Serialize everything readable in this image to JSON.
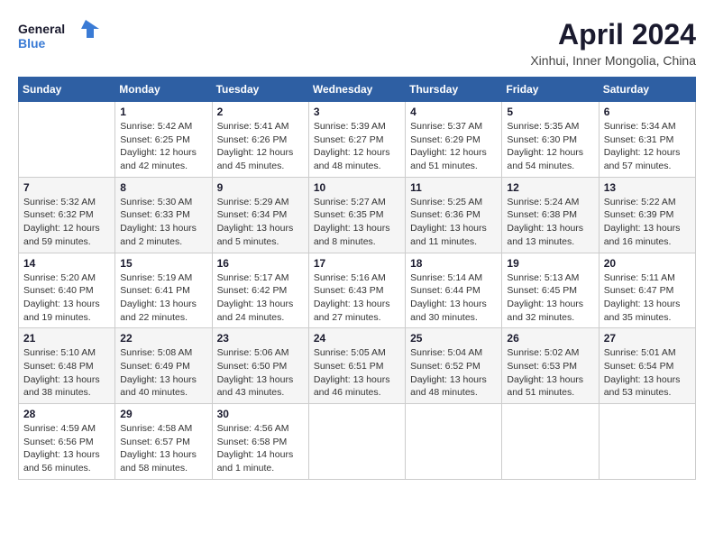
{
  "header": {
    "logo_line1": "General",
    "logo_line2": "Blue",
    "month_title": "April 2024",
    "subtitle": "Xinhui, Inner Mongolia, China"
  },
  "weekdays": [
    "Sunday",
    "Monday",
    "Tuesday",
    "Wednesday",
    "Thursday",
    "Friday",
    "Saturday"
  ],
  "weeks": [
    [
      {
        "day": "",
        "info": ""
      },
      {
        "day": "1",
        "info": "Sunrise: 5:42 AM\nSunset: 6:25 PM\nDaylight: 12 hours\nand 42 minutes."
      },
      {
        "day": "2",
        "info": "Sunrise: 5:41 AM\nSunset: 6:26 PM\nDaylight: 12 hours\nand 45 minutes."
      },
      {
        "day": "3",
        "info": "Sunrise: 5:39 AM\nSunset: 6:27 PM\nDaylight: 12 hours\nand 48 minutes."
      },
      {
        "day": "4",
        "info": "Sunrise: 5:37 AM\nSunset: 6:29 PM\nDaylight: 12 hours\nand 51 minutes."
      },
      {
        "day": "5",
        "info": "Sunrise: 5:35 AM\nSunset: 6:30 PM\nDaylight: 12 hours\nand 54 minutes."
      },
      {
        "day": "6",
        "info": "Sunrise: 5:34 AM\nSunset: 6:31 PM\nDaylight: 12 hours\nand 57 minutes."
      }
    ],
    [
      {
        "day": "7",
        "info": "Sunrise: 5:32 AM\nSunset: 6:32 PM\nDaylight: 12 hours\nand 59 minutes."
      },
      {
        "day": "8",
        "info": "Sunrise: 5:30 AM\nSunset: 6:33 PM\nDaylight: 13 hours\nand 2 minutes."
      },
      {
        "day": "9",
        "info": "Sunrise: 5:29 AM\nSunset: 6:34 PM\nDaylight: 13 hours\nand 5 minutes."
      },
      {
        "day": "10",
        "info": "Sunrise: 5:27 AM\nSunset: 6:35 PM\nDaylight: 13 hours\nand 8 minutes."
      },
      {
        "day": "11",
        "info": "Sunrise: 5:25 AM\nSunset: 6:36 PM\nDaylight: 13 hours\nand 11 minutes."
      },
      {
        "day": "12",
        "info": "Sunrise: 5:24 AM\nSunset: 6:38 PM\nDaylight: 13 hours\nand 13 minutes."
      },
      {
        "day": "13",
        "info": "Sunrise: 5:22 AM\nSunset: 6:39 PM\nDaylight: 13 hours\nand 16 minutes."
      }
    ],
    [
      {
        "day": "14",
        "info": "Sunrise: 5:20 AM\nSunset: 6:40 PM\nDaylight: 13 hours\nand 19 minutes."
      },
      {
        "day": "15",
        "info": "Sunrise: 5:19 AM\nSunset: 6:41 PM\nDaylight: 13 hours\nand 22 minutes."
      },
      {
        "day": "16",
        "info": "Sunrise: 5:17 AM\nSunset: 6:42 PM\nDaylight: 13 hours\nand 24 minutes."
      },
      {
        "day": "17",
        "info": "Sunrise: 5:16 AM\nSunset: 6:43 PM\nDaylight: 13 hours\nand 27 minutes."
      },
      {
        "day": "18",
        "info": "Sunrise: 5:14 AM\nSunset: 6:44 PM\nDaylight: 13 hours\nand 30 minutes."
      },
      {
        "day": "19",
        "info": "Sunrise: 5:13 AM\nSunset: 6:45 PM\nDaylight: 13 hours\nand 32 minutes."
      },
      {
        "day": "20",
        "info": "Sunrise: 5:11 AM\nSunset: 6:47 PM\nDaylight: 13 hours\nand 35 minutes."
      }
    ],
    [
      {
        "day": "21",
        "info": "Sunrise: 5:10 AM\nSunset: 6:48 PM\nDaylight: 13 hours\nand 38 minutes."
      },
      {
        "day": "22",
        "info": "Sunrise: 5:08 AM\nSunset: 6:49 PM\nDaylight: 13 hours\nand 40 minutes."
      },
      {
        "day": "23",
        "info": "Sunrise: 5:06 AM\nSunset: 6:50 PM\nDaylight: 13 hours\nand 43 minutes."
      },
      {
        "day": "24",
        "info": "Sunrise: 5:05 AM\nSunset: 6:51 PM\nDaylight: 13 hours\nand 46 minutes."
      },
      {
        "day": "25",
        "info": "Sunrise: 5:04 AM\nSunset: 6:52 PM\nDaylight: 13 hours\nand 48 minutes."
      },
      {
        "day": "26",
        "info": "Sunrise: 5:02 AM\nSunset: 6:53 PM\nDaylight: 13 hours\nand 51 minutes."
      },
      {
        "day": "27",
        "info": "Sunrise: 5:01 AM\nSunset: 6:54 PM\nDaylight: 13 hours\nand 53 minutes."
      }
    ],
    [
      {
        "day": "28",
        "info": "Sunrise: 4:59 AM\nSunset: 6:56 PM\nDaylight: 13 hours\nand 56 minutes."
      },
      {
        "day": "29",
        "info": "Sunrise: 4:58 AM\nSunset: 6:57 PM\nDaylight: 13 hours\nand 58 minutes."
      },
      {
        "day": "30",
        "info": "Sunrise: 4:56 AM\nSunset: 6:58 PM\nDaylight: 14 hours\nand 1 minute."
      },
      {
        "day": "",
        "info": ""
      },
      {
        "day": "",
        "info": ""
      },
      {
        "day": "",
        "info": ""
      },
      {
        "day": "",
        "info": ""
      }
    ]
  ]
}
